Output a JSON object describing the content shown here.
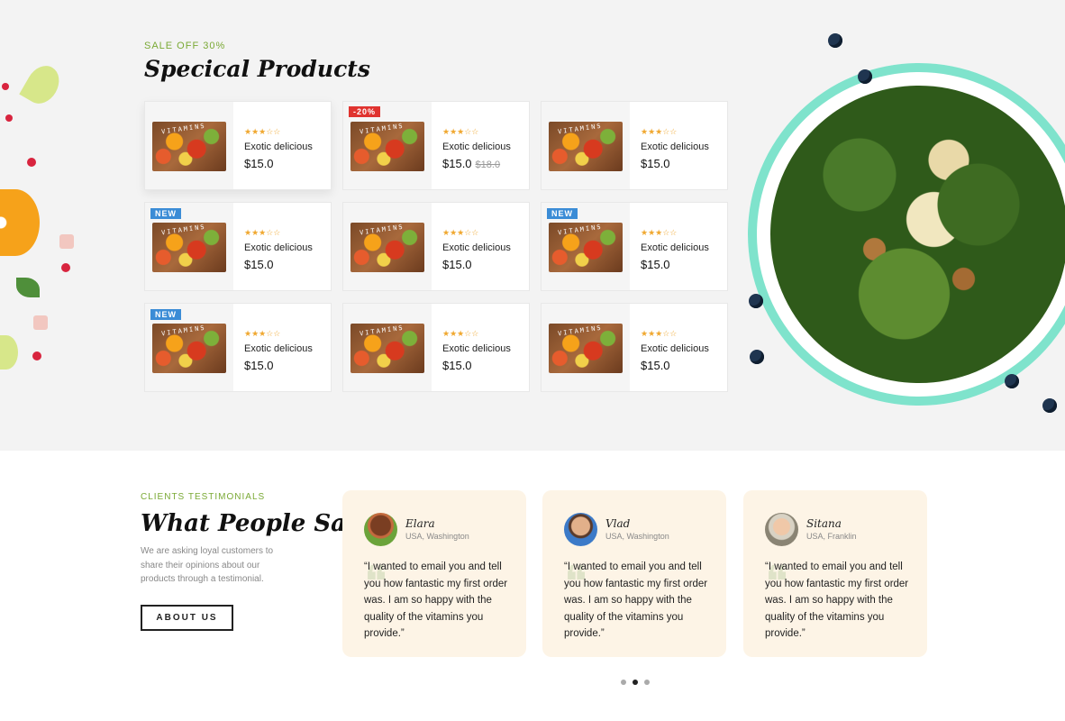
{
  "products_section": {
    "eyebrow": "SALE OFF 30%",
    "title": "Specical Products",
    "products": [
      {
        "name": "Exotic delicious",
        "price": "$15.0",
        "old_price": "",
        "badge": "",
        "stars": "★★★☆☆"
      },
      {
        "name": "Exotic delicious",
        "price": "$15.0",
        "old_price": "$18.0",
        "badge": "-20%",
        "stars": "★★★☆☆"
      },
      {
        "name": "Exotic delicious",
        "price": "$15.0",
        "old_price": "",
        "badge": "",
        "stars": "★★★☆☆"
      },
      {
        "name": "Exotic delicious",
        "price": "$15.0",
        "old_price": "",
        "badge": "NEW",
        "stars": "★★★☆☆"
      },
      {
        "name": "Exotic delicious",
        "price": "$15.0",
        "old_price": "",
        "badge": "",
        "stars": "★★★☆☆"
      },
      {
        "name": "Exotic delicious",
        "price": "$15.0",
        "old_price": "",
        "badge": "NEW",
        "stars": "★★★☆☆"
      },
      {
        "name": "Exotic delicious",
        "price": "$15.0",
        "old_price": "",
        "badge": "NEW",
        "stars": "★★★☆☆"
      },
      {
        "name": "Exotic delicious",
        "price": "$15.0",
        "old_price": "",
        "badge": "",
        "stars": "★★★☆☆"
      },
      {
        "name": "Exotic delicious",
        "price": "$15.0",
        "old_price": "",
        "badge": "",
        "stars": "★★★☆☆"
      }
    ],
    "thumb_word": "VITAMINS"
  },
  "testimonials": {
    "eyebrow": "CLIENTS TESTIMONIALS",
    "title": "What People Say?",
    "description": "We are asking loyal customers to share their opinions about our products through a testimonial.",
    "about_button": "ABOUT US",
    "items": [
      {
        "name": "Elara",
        "location": "USA, Washington",
        "text": "“I wanted to email you and tell you how fantastic my first order was. I am so happy with the quality of the vitamins you provide.”",
        "avatar_color": "#8a4a2a"
      },
      {
        "name": "Vlad",
        "location": "USA, Washington",
        "text": "“I wanted to email you and tell you how fantastic my first order was. I am so happy with the quality of the vitamins you provide.”",
        "avatar_color": "#3c7ac8"
      },
      {
        "name": "Sitana",
        "location": "USA, Franklin",
        "text": "“I wanted to email you and tell you how fantastic my first order was. I am so happy with the quality of the vitamins you provide.”",
        "avatar_color": "#c9a07a"
      }
    ],
    "pager_active_index": 1,
    "pager_count": 3
  },
  "colors": {
    "accent_green": "#7aa935",
    "badge_new": "#3b8cd6",
    "badge_sale": "#e0332f",
    "card_bg": "#fdf4e6"
  }
}
